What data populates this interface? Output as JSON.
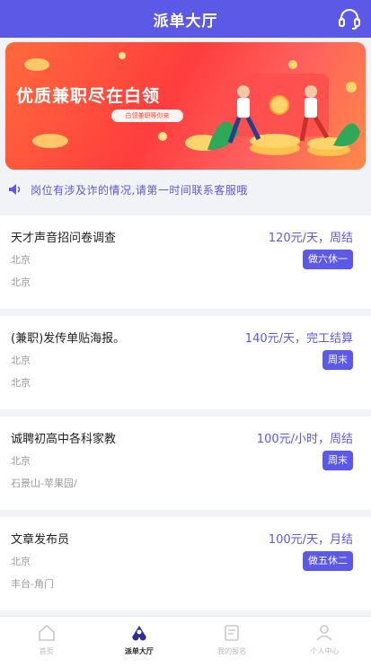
{
  "header": {
    "title": "派单大厅",
    "icon": "headset-icon"
  },
  "banner": {
    "title": "优质兼职尽在白领",
    "pill": "白领兼职等你来",
    "colors": {
      "start": "#ff6a3d",
      "end": "#ff8a4a"
    }
  },
  "notice": {
    "icon": "speaker-icon",
    "text": "岗位有涉及诈的情况,请第一时间联系客服哦"
  },
  "jobs": [
    {
      "title": "天才声音招问卷调查",
      "pay": "120元/天，周结",
      "city": "北京",
      "area": "北京",
      "tag": "做六休一"
    },
    {
      "title": "(兼职)发传单贴海报。",
      "pay": "140元/天，完工结算",
      "city": "北京",
      "area": "北京",
      "tag": "周末"
    },
    {
      "title": "诚聘初高中各科家教",
      "pay": "100元/小时，周结",
      "city": "北京",
      "area": "石景山-苹果园/",
      "tag": "周末"
    },
    {
      "title": "文章发布员",
      "pay": "100元/天，月结",
      "city": "北京",
      "area": "丰台-角门",
      "tag": "做五休二"
    }
  ],
  "tabs": [
    {
      "label": "首页",
      "icon": "home-icon",
      "active": false
    },
    {
      "label": "派单大厅",
      "icon": "hall-icon",
      "active": true
    },
    {
      "label": "我的报名",
      "icon": "list-icon",
      "active": false
    },
    {
      "label": "个人中心",
      "icon": "user-icon",
      "active": false
    }
  ],
  "colors": {
    "accent": "#5b59e6",
    "background": "#f2f3f7"
  }
}
